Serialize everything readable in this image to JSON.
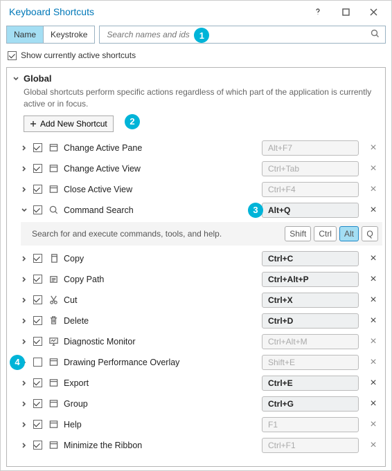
{
  "window": {
    "title": "Keyboard Shortcuts"
  },
  "filter": {
    "tabs": [
      "Name",
      "Keystroke"
    ],
    "active_tab_index": 0,
    "search_placeholder": "Search names and ids"
  },
  "show_active": {
    "label": "Show currently active shortcuts",
    "checked": true
  },
  "group": {
    "name": "Global",
    "description": "Global shortcuts perform specific actions regardless of which part of the application is currently active or in focus.",
    "add_button": "Add New Shortcut"
  },
  "command_search_detail": {
    "description": "Search for and execute commands, tools, and help.",
    "keys": [
      {
        "label": "Shift",
        "active": false
      },
      {
        "label": "Ctrl",
        "active": false
      },
      {
        "label": "Alt",
        "active": true
      },
      {
        "label": "Q",
        "active": false
      }
    ]
  },
  "callouts": [
    "1",
    "2",
    "3",
    "4"
  ],
  "rows": [
    {
      "expanded": false,
      "checked": true,
      "icon": "window",
      "label": "Change Active Pane",
      "shortcut": "Alt+F7",
      "bold": false,
      "removable": false
    },
    {
      "expanded": false,
      "checked": true,
      "icon": "window",
      "label": "Change Active View",
      "shortcut": "Ctrl+Tab",
      "bold": false,
      "removable": false
    },
    {
      "expanded": false,
      "checked": true,
      "icon": "window",
      "label": "Close Active View",
      "shortcut": "Ctrl+F4",
      "bold": false,
      "removable": false
    },
    {
      "expanded": true,
      "checked": true,
      "icon": "search",
      "label": "Command Search",
      "shortcut": "Alt+Q",
      "bold": true,
      "removable": true,
      "detail": true
    },
    {
      "expanded": false,
      "checked": true,
      "icon": "copy",
      "label": "Copy",
      "shortcut": "Ctrl+C",
      "bold": true,
      "removable": true
    },
    {
      "expanded": false,
      "checked": true,
      "icon": "copypath",
      "label": "Copy Path",
      "shortcut": "Ctrl+Alt+P",
      "bold": true,
      "removable": true
    },
    {
      "expanded": false,
      "checked": true,
      "icon": "cut",
      "label": "Cut",
      "shortcut": "Ctrl+X",
      "bold": true,
      "removable": true
    },
    {
      "expanded": false,
      "checked": true,
      "icon": "trash",
      "label": "Delete",
      "shortcut": "Ctrl+D",
      "bold": true,
      "removable": true
    },
    {
      "expanded": false,
      "checked": true,
      "icon": "monitor",
      "label": "Diagnostic Monitor",
      "shortcut": "Ctrl+Alt+M",
      "bold": false,
      "removable": false
    },
    {
      "expanded": false,
      "checked": false,
      "icon": "window",
      "label": "Drawing Performance Overlay",
      "shortcut": "Shift+E",
      "bold": false,
      "removable": false
    },
    {
      "expanded": false,
      "checked": true,
      "icon": "window",
      "label": "Export",
      "shortcut": "Ctrl+E",
      "bold": true,
      "removable": true
    },
    {
      "expanded": false,
      "checked": true,
      "icon": "window",
      "label": "Group",
      "shortcut": "Ctrl+G",
      "bold": true,
      "removable": true
    },
    {
      "expanded": false,
      "checked": true,
      "icon": "window",
      "label": "Help",
      "shortcut": "F1",
      "bold": false,
      "removable": false
    },
    {
      "expanded": false,
      "checked": true,
      "icon": "window",
      "label": "Minimize the Ribbon",
      "shortcut": "Ctrl+F1",
      "bold": false,
      "removable": false
    }
  ]
}
